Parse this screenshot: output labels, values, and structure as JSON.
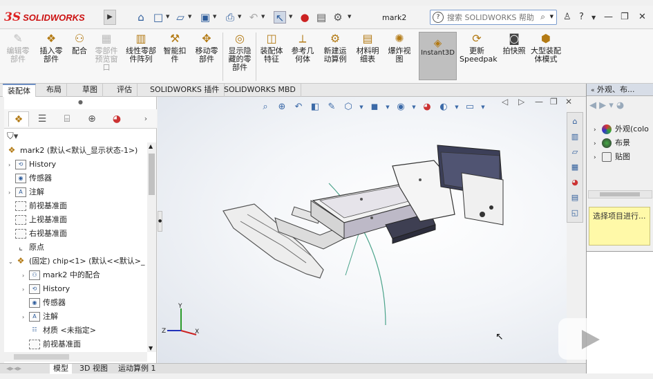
{
  "titlebar": {
    "logo_mark": "3S",
    "logo_text": "SOLIDWORKS",
    "doc_title": "mark2",
    "search_placeholder": "搜索 SOLIDWORKS 帮助"
  },
  "commands": [
    {
      "label": "编辑零部件",
      "disabled": true
    },
    {
      "label": "插入零部件"
    },
    {
      "label": "配合"
    },
    {
      "label": "零部件预览窗口",
      "disabled": true
    },
    {
      "label": "线性零部件阵列"
    },
    {
      "label": "智能扣件"
    },
    {
      "label": "移动零部件"
    },
    {
      "label": "显示隐藏的零部件"
    },
    {
      "label": "装配体特征"
    },
    {
      "label": "参考几何体"
    },
    {
      "label": "新建运动算例"
    },
    {
      "label": "材料明细表"
    },
    {
      "label": "爆炸视图"
    },
    {
      "label": "Instant3D"
    },
    {
      "label": "更新Speedpak"
    },
    {
      "label": "拍快照"
    },
    {
      "label": "大型装配体模式"
    }
  ],
  "tabs": [
    "装配体",
    "布局",
    "草图",
    "评估",
    "SOLIDWORKS 插件",
    "SOLIDWORKS MBD"
  ],
  "tree": {
    "root": "mark2 (默认<默认_显示状态-1>)",
    "items": [
      {
        "label": "History"
      },
      {
        "label": "传感器"
      },
      {
        "label": "注解"
      },
      {
        "label": "前视基准面"
      },
      {
        "label": "上视基准面"
      },
      {
        "label": "右视基准面"
      },
      {
        "label": "原点"
      },
      {
        "label": "(固定) chip<1> (默认<<默认>_"
      },
      {
        "label": "mark2 中的配合"
      },
      {
        "label": "History"
      },
      {
        "label": "传感器"
      },
      {
        "label": "注解"
      },
      {
        "label": "材质 <未指定>"
      },
      {
        "label": "前视基准面"
      }
    ]
  },
  "bottom_tabs": [
    "模型",
    "3D 视图",
    "运动算例 1"
  ],
  "right_pane": {
    "title": "外观、布...",
    "items": [
      "外观(colo",
      "布景",
      "贴图"
    ],
    "prompt": "选择项目进行..."
  },
  "triad": {
    "x": "X",
    "y": "Y",
    "z": "Z"
  },
  "colors": {
    "accent": "#2d5c9b",
    "brand": "#cc1111",
    "highlight": "#fff9a8"
  }
}
